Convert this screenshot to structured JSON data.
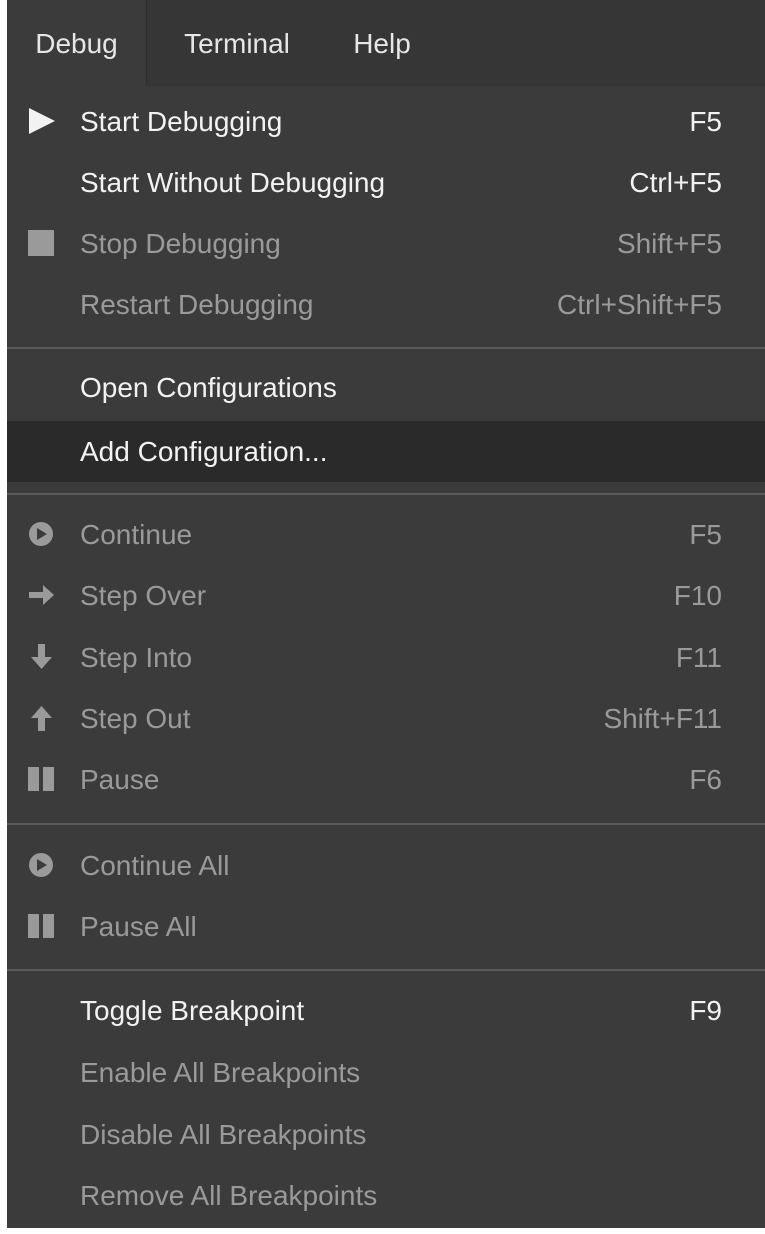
{
  "menubar": {
    "tabs": [
      {
        "label": "Debug"
      },
      {
        "label": "Terminal"
      },
      {
        "label": "Help"
      }
    ]
  },
  "menu": {
    "items": [
      {
        "label": "Start Debugging",
        "shortcut": "F5",
        "icon": "play-icon",
        "enabled": true
      },
      {
        "label": "Start Without Debugging",
        "shortcut": "Ctrl+F5",
        "icon": "",
        "enabled": true
      },
      {
        "label": "Stop Debugging",
        "shortcut": "Shift+F5",
        "icon": "stop-icon",
        "enabled": false
      },
      {
        "label": "Restart Debugging",
        "shortcut": "Ctrl+Shift+F5",
        "icon": "",
        "enabled": false
      },
      {
        "label": "Open Configurations",
        "shortcut": "",
        "icon": "",
        "enabled": true
      },
      {
        "label": "Add Configuration...",
        "shortcut": "",
        "icon": "",
        "enabled": true,
        "highlighted": true
      },
      {
        "label": "Continue",
        "shortcut": "F5",
        "icon": "continue-icon",
        "enabled": false
      },
      {
        "label": "Step Over",
        "shortcut": "F10",
        "icon": "arrow-right-icon",
        "enabled": false
      },
      {
        "label": "Step Into",
        "shortcut": "F11",
        "icon": "arrow-down-icon",
        "enabled": false
      },
      {
        "label": "Step Out",
        "shortcut": "Shift+F11",
        "icon": "arrow-up-icon",
        "enabled": false
      },
      {
        "label": "Pause",
        "shortcut": "F6",
        "icon": "pause-icon",
        "enabled": false
      },
      {
        "label": "Continue All",
        "shortcut": "",
        "icon": "continue-icon",
        "enabled": false
      },
      {
        "label": "Pause All",
        "shortcut": "",
        "icon": "pause-icon",
        "enabled": false
      },
      {
        "label": "Toggle Breakpoint",
        "shortcut": "F9",
        "icon": "",
        "enabled": true
      },
      {
        "label": "Enable All Breakpoints",
        "shortcut": "",
        "icon": "",
        "enabled": false
      },
      {
        "label": "Disable All Breakpoints",
        "shortcut": "",
        "icon": "",
        "enabled": false
      },
      {
        "label": "Remove All Breakpoints",
        "shortcut": "",
        "icon": "",
        "enabled": false
      }
    ]
  },
  "colors": {
    "menu_bg": "#3b3b3b",
    "highlight_bg": "#2a2a2a",
    "enabled_text": "#f2f2f2",
    "disabled_text": "#9a9a9a",
    "separator": "#5a5a5a"
  }
}
